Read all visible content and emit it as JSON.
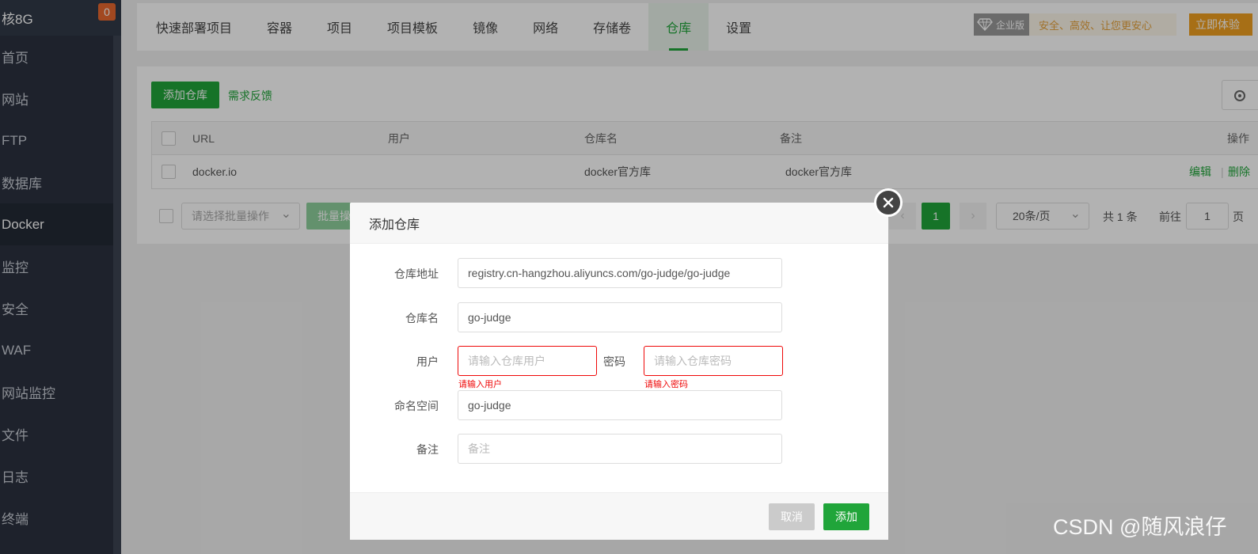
{
  "sidebar": {
    "header": "核8G",
    "badge": "0",
    "items": [
      {
        "label": "首页"
      },
      {
        "label": "网站"
      },
      {
        "label": "FTP"
      },
      {
        "label": "数据库"
      },
      {
        "label": "Docker"
      },
      {
        "label": "监控"
      },
      {
        "label": "安全"
      },
      {
        "label": "WAF"
      },
      {
        "label": "网站监控"
      },
      {
        "label": "文件"
      },
      {
        "label": "日志"
      },
      {
        "label": "终端"
      }
    ],
    "active": "Docker"
  },
  "topnav": {
    "tabs": [
      {
        "label": "快速部署项目"
      },
      {
        "label": "容器"
      },
      {
        "label": "项目"
      },
      {
        "label": "项目模板"
      },
      {
        "label": "镜像"
      },
      {
        "label": "网络"
      },
      {
        "label": "存储卷"
      },
      {
        "label": "仓库"
      },
      {
        "label": "设置"
      }
    ],
    "active_tab": "仓库",
    "enterprise_tag": "企业版",
    "enterprise_slogan": "安全、高效、让您更安心",
    "try_button": "立即体验"
  },
  "toolbar": {
    "add_button": "添加仓库",
    "feedback_link": "需求反馈"
  },
  "table": {
    "columns": [
      "URL",
      "用户",
      "仓库名",
      "备注",
      "操作"
    ],
    "rows": [
      {
        "url": "docker.io",
        "user": "",
        "name": "docker官方库",
        "remark": "docker官方库",
        "edit": "编辑",
        "delete": "删除"
      }
    ]
  },
  "footer": {
    "batch_select_placeholder": "请选择批量操作",
    "batch_button": "批量操作",
    "current_page": "1",
    "page_size": "20条/页",
    "total": "共 1 条",
    "goto_label": "前往",
    "goto_value": "1",
    "page_unit": "页"
  },
  "modal": {
    "title": "添加仓库",
    "fields": {
      "address_label": "仓库地址",
      "address_value": "registry.cn-hangzhou.aliyuncs.com/go-judge/go-judge",
      "name_label": "仓库名",
      "name_value": "go-judge",
      "user_label": "用户",
      "user_placeholder": "请输入仓库用户",
      "user_error": "请输入用户",
      "password_label": "密码",
      "password_placeholder": "请输入仓库密码",
      "password_error": "请输入密码",
      "namespace_label": "命名空间",
      "namespace_value": "go-judge",
      "remark_label": "备注",
      "remark_placeholder": "备注"
    },
    "cancel_button": "取消",
    "confirm_button": "添加"
  },
  "watermark": "CSDN @随风浪仔",
  "colors": {
    "accent": "#20a53a",
    "error": "#ef0808",
    "sidebar_bg": "#2b3240",
    "badge": "#e8682f",
    "enterprise": "#e6a23c"
  }
}
